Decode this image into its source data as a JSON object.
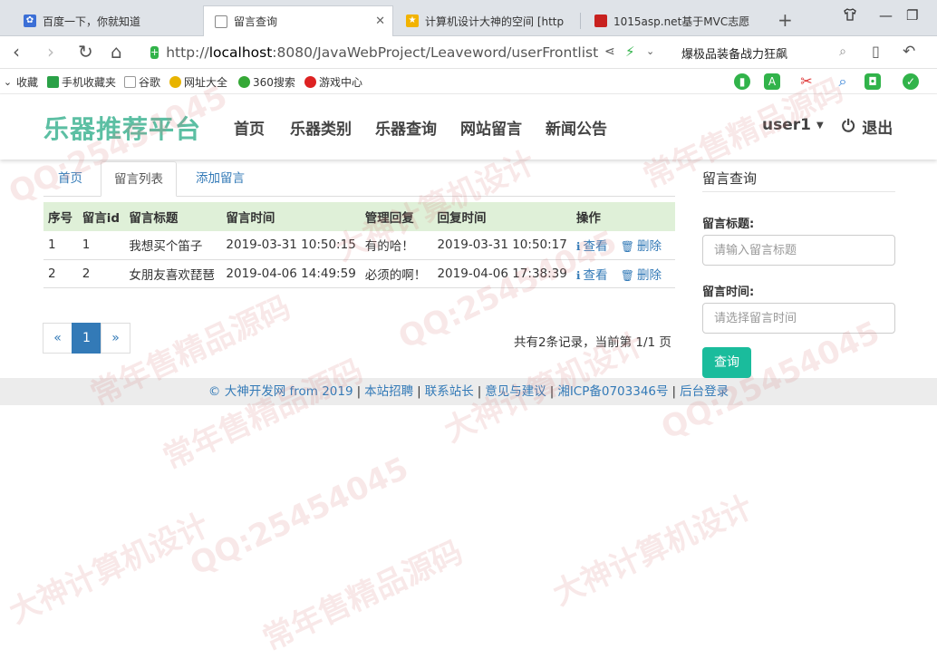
{
  "browser": {
    "tabs": [
      {
        "title": "百度一下，你就知道",
        "icon": "paw-icon"
      },
      {
        "title": "留言查询",
        "icon": "page-icon",
        "close": "✕"
      },
      {
        "title": "计算机设计大神的空间 [http",
        "icon": "star-icon"
      },
      {
        "title": "1015asp.net基于MVC志愿",
        "icon": "red-square-icon"
      }
    ],
    "url_prefix": "http://",
    "url_host": "localhost",
    "url_rest": ":8080/JavaWebProject/Leaveword/userFrontlist",
    "search_text": "爆极品装备战力狂飙",
    "bookmarks": [
      "收藏",
      "手机收藏夹",
      "谷歌",
      "网址大全",
      "360搜索",
      "游戏中心"
    ]
  },
  "site": {
    "brand": "乐器推荐平台",
    "menu": [
      "首页",
      "乐器类别",
      "乐器查询",
      "网站留言",
      "新闻公告"
    ],
    "user": "user1",
    "logout": "退出"
  },
  "subtabs": [
    "首页",
    "留言列表",
    "添加留言"
  ],
  "table": {
    "headers": [
      "序号",
      "留言id",
      "留言标题",
      "留言时间",
      "管理回复",
      "回复时间",
      "操作"
    ],
    "rows": [
      {
        "no": "1",
        "id": "1",
        "title": "我想买个笛子",
        "time": "2019-03-31 10:50:15",
        "reply": "有的哈！",
        "reply_time": "2019-03-31 10:50:17",
        "view": "查看",
        "delete": "删除"
      },
      {
        "no": "2",
        "id": "2",
        "title": "女朋友喜欢琵琶",
        "time": "2019-04-06 14:49:59",
        "reply": "必须的啊！",
        "reply_time": "2019-04-06 17:38:39",
        "view": "查看",
        "delete": "删除"
      }
    ]
  },
  "pager": {
    "prev": "«",
    "current": "1",
    "next": "»",
    "info": "共有2条记录，当前第 1/1 页"
  },
  "sidebar": {
    "title": "留言查询",
    "title_label": "留言标题:",
    "title_placeholder": "请输入留言标题",
    "time_label": "留言时间:",
    "time_placeholder": "请选择留言时间",
    "query_button": "查询"
  },
  "footer": [
    "© 大神开发网 from 2019",
    "本站招聘",
    "联系站长",
    "意见与建议",
    "湘ICP备0703346号",
    "后台登录"
  ],
  "watermark": [
    "QQ:25454045",
    "大神计算机设计",
    "常年售精品源码",
    "QQ:25454045",
    "常年售精品源码",
    "大神计算机设计",
    "QQ:25454045",
    "常年售精品源码",
    "大神计算机设计",
    "QQ:25454045",
    "常年售精品源码",
    "大神计算机设计"
  ]
}
